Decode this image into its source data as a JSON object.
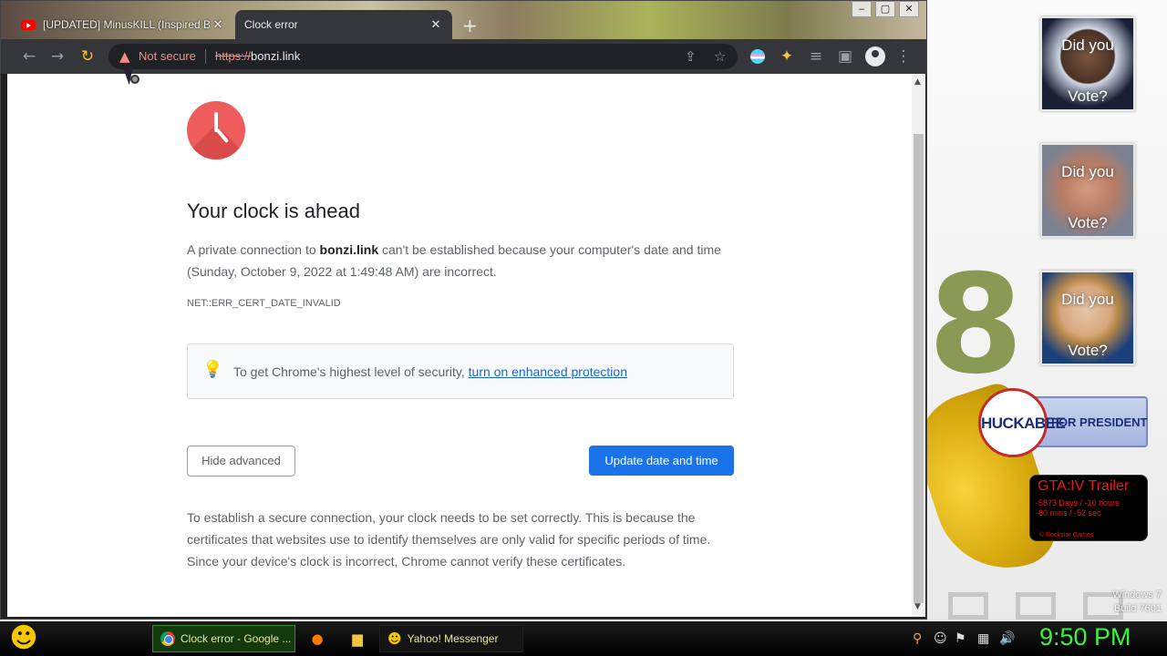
{
  "browser": {
    "tabs": [
      {
        "title": "[UPDATED] MinusKILL (Inspired B...",
        "active": false
      },
      {
        "title": "Clock error",
        "active": true
      }
    ],
    "new_tab": "+",
    "window_controls": [
      "‒",
      "▢",
      "✕"
    ],
    "omnibox": {
      "security_label": "Not secure",
      "url_scheme": "https://",
      "url_host": "bonzi.link"
    }
  },
  "page": {
    "heading": "Your clock is ahead",
    "para_prefix": "A private connection to ",
    "para_host": "bonzi.link",
    "para_suffix": " can't be established because your computer's date and time (Sunday, October 9, 2022 at 1:49:48 AM) are incorrect.",
    "error_code": "NET::ERR_CERT_DATE_INVALID",
    "info_text": "To get Chrome's highest level of security, ",
    "info_link": "turn on enhanced protection",
    "hide_advanced": "Hide advanced",
    "update_button": "Update date and time",
    "explanation": "To establish a secure connection, your clock needs to be set correctly. This is because the certificates that websites use to identify themselves are only valid for specific periods of time. Since your device's clock is incorrect, Chrome cannot verify these certificates."
  },
  "desktop": {
    "tiles": [
      {
        "line1": "Did you",
        "line2": "Vote?"
      },
      {
        "line1": "Did you",
        "line2": "Vote?"
      },
      {
        "line1": "Did you",
        "line2": "Vote?"
      }
    ],
    "huckabee": {
      "name": "HUCKABEE",
      "sub": "FOR PRESIDENT"
    },
    "gta": {
      "title": "GTA:IV  Trailer",
      "countdown_1": "-5873 Days / -10 hours",
      "countdown_2": "-80 mins / -52 sec",
      "footer": "© Rockstar Games"
    },
    "windows_version_1": "Windows 7",
    "windows_version_2": "Build 7601",
    "eight": "8"
  },
  "taskbar": {
    "chrome_task": "Clock error - Google ...",
    "yahoo_task": "Yahoo! Messenger",
    "time": "9:50 PM"
  },
  "colors": {
    "accent": "#1a73e8",
    "not_secure": "#f28b82",
    "clock_green": "#3df23d",
    "error_red": "#ee5c5c"
  }
}
